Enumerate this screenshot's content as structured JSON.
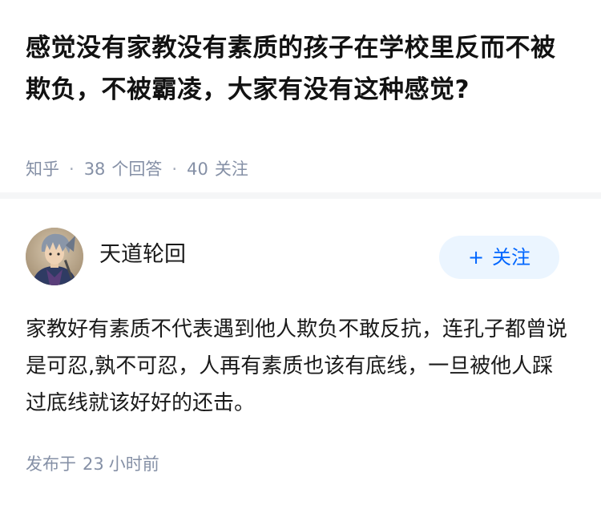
{
  "question": {
    "title": "感觉没有家教没有素质的孩子在学校里反而不被欺负，不被霸凌，大家有没有这种感觉?",
    "source": "知乎",
    "separator": "·",
    "answer_count": "38",
    "answer_unit": "个回答",
    "follow_count": "40",
    "follow_unit": "关注"
  },
  "answer": {
    "author_name": "天道轮回",
    "avatar_icon": "avatar-image-icon",
    "follow_button": {
      "icon": "plus-icon",
      "plus_symbol": "+",
      "label": "关注"
    },
    "content": "家教好有素质不代表遇到他人欺负不敢反抗，连孔子都曾说是可忍,孰不可忍，人再有素质也该有底线，一旦被他人踩过底线就该好好的还击。",
    "time_prefix": "发布于",
    "time_value": "23",
    "time_unit": "小时前"
  },
  "colors": {
    "title": "#121212",
    "meta": "#8590a6",
    "follow_button_bg": "#ebf5ff",
    "follow_button_text": "#0066ff",
    "divider": "#f5f6f7"
  }
}
